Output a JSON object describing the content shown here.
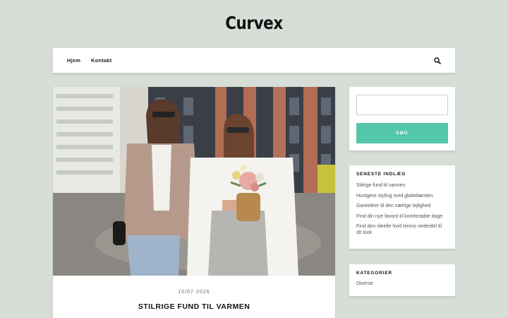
{
  "site": {
    "title": "Curvex"
  },
  "nav": {
    "items": [
      {
        "label": "Hjem"
      },
      {
        "label": "Kontakt"
      }
    ],
    "search_icon": "search-icon"
  },
  "post": {
    "date": "15/07-2026",
    "title": "STILRIGE FUND TIL VARMEN"
  },
  "sidebar": {
    "search": {
      "input_value": "",
      "button_label": "SØG"
    },
    "recent": {
      "title": "SENESTE INDLÆG",
      "items": [
        "Stilrige fund til varmen",
        "Hurtigere styling med glattebørsten",
        "Gaveidéer til den særlige lejlighed",
        "Find din nye favorit til komfortable dage",
        "Find den ideelle hvid tennis nederdel til dit look"
      ]
    },
    "categories": {
      "title": "KATEGORIER",
      "items": [
        "Diverse"
      ]
    }
  },
  "colors": {
    "background": "#d7ded8",
    "accent": "#54c7aa"
  }
}
